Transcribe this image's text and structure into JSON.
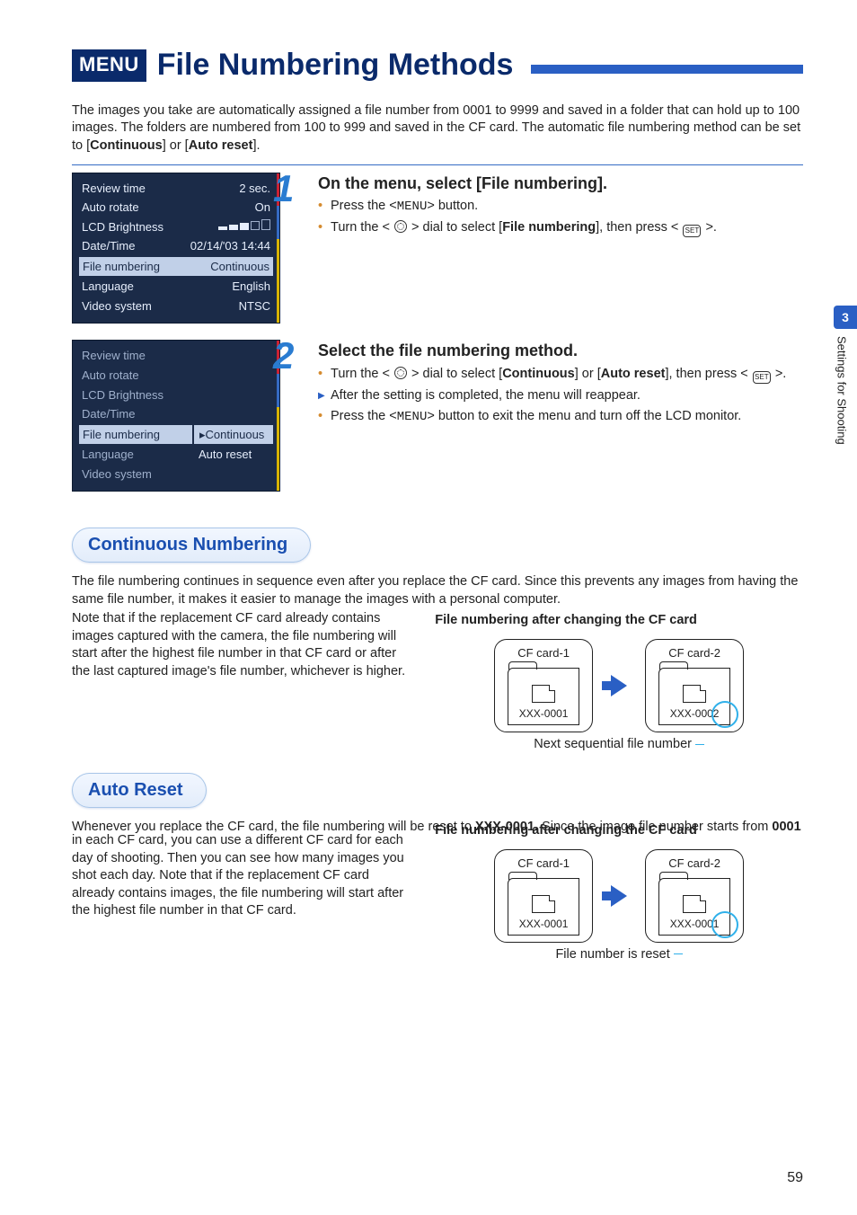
{
  "header": {
    "menu_badge": "MENU",
    "title": "File Numbering Methods"
  },
  "intro": {
    "text_before_continuous": "The images you take are automatically assigned a file number from 0001 to 9999 and saved in a folder that can hold up to 100 images. The folders are numbered from 100 to 999 and saved in the CF card. The automatic file numbering method can be set to [",
    "continuous": "Continuous",
    "between": "] or [",
    "auto_reset": "Auto reset",
    "after": "]."
  },
  "lcd1": {
    "rows": [
      {
        "label": "Review time",
        "value": "2 sec."
      },
      {
        "label": "Auto rotate",
        "value": "On"
      },
      {
        "label": "LCD Brightness",
        "value": "BARS"
      },
      {
        "label": "Date/Time",
        "value": "02/14/'03 14:44"
      },
      {
        "label": "File numbering",
        "value": "Continuous",
        "selected": true
      },
      {
        "label": "Language",
        "value": "English"
      },
      {
        "label": "Video system",
        "value": "NTSC"
      }
    ]
  },
  "lcd2": {
    "rows": [
      {
        "label": "Review time"
      },
      {
        "label": "Auto rotate"
      },
      {
        "label": "LCD Brightness"
      },
      {
        "label": "Date/Time"
      },
      {
        "label": "File numbering",
        "selected": true,
        "options": [
          "Continuous",
          "Auto reset"
        ],
        "active": 0
      },
      {
        "label": "Language"
      },
      {
        "label": "Video system"
      }
    ]
  },
  "steps": [
    {
      "number": "1",
      "title": "On the menu, select [File numbering].",
      "bullets": [
        {
          "style": "orange",
          "text_pre": "Press the <",
          "mono": "MENU",
          "text_post": "> button."
        },
        {
          "style": "orange",
          "text_pre": "Turn the < ",
          "icon": "dial",
          "text_mid": " > dial to select [",
          "bold": "File numbering",
          "text_mid2": "], then press < ",
          "icon2": "set",
          "text_post": " >."
        }
      ]
    },
    {
      "number": "2",
      "title": "Select the file numbering method.",
      "bullets": [
        {
          "style": "orange",
          "text_pre": "Turn the < ",
          "icon": "dial",
          "text_mid": " > dial to select [",
          "bold": "Continuous",
          "text_mid2": "] or [",
          "bold2": "Auto reset",
          "text_mid3": "], then press < ",
          "icon2": "set",
          "text_post": " >."
        },
        {
          "style": "arrow",
          "plain": "After the setting is completed, the menu will reappear."
        },
        {
          "style": "orange",
          "text_pre": "Press the <",
          "mono": "MENU",
          "text_post": "> button to exit the menu and turn off the LCD monitor."
        }
      ]
    }
  ],
  "sections": {
    "continuous": {
      "heading": "Continuous Numbering",
      "p1": "The file numbering continues in sequence even after you replace the CF card. Since this prevents any images from having the same file number, it makes it easier to manage the images with a personal computer.",
      "p2": "Note that if the replacement CF card already contains images captured with the camera, the file numbering will start after the highest file number in that CF card or after the last captured image's file number, whichever is higher.",
      "diagram_title": "File numbering after changing the CF card",
      "card1_label": "CF card-1",
      "card2_label": "CF card-2",
      "file1": "XXX-0001",
      "file2": "XXX-0002",
      "caption": "Next sequential file number"
    },
    "auto_reset": {
      "heading": "Auto Reset",
      "p1_a": "Whenever you replace the CF card, the file numbering will be reset to ",
      "p1_b": "XXX-0001.",
      "p1_c": " Since the image file number starts from ",
      "p1_d": "0001",
      "p1_e": " in each CF card, you can use a different CF card for each day of shooting. Then you can see how many images you shot each day. Note that if the replacement CF card already contains images, the file numbering will start after the highest file number in that CF card.",
      "diagram_title": "File numbering after changing the CF card",
      "card1_label": "CF card-1",
      "card2_label": "CF card-2",
      "file1": "XXX-0001",
      "file2": "XXX-0001",
      "caption": "File number is reset"
    }
  },
  "side_tab": {
    "chapter": "3",
    "label": "Settings for Shooting"
  },
  "page_number": "59"
}
